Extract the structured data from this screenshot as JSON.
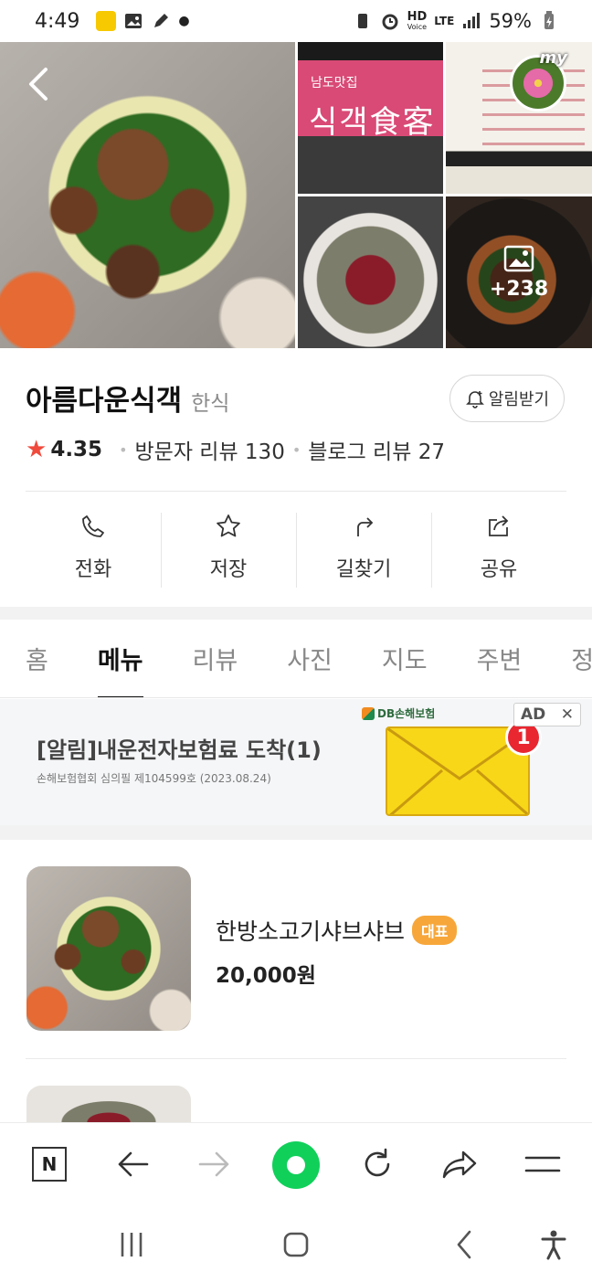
{
  "status_bar": {
    "time": "4:49",
    "hd_label": "HD",
    "voice_label": "Voice",
    "lte_label": "LTE",
    "battery": "59%"
  },
  "photos": {
    "sign_small": "남도맛집",
    "sign_big": "식객食客",
    "more_count": "+238"
  },
  "place": {
    "name": "아름다운식객",
    "category": "한식",
    "alarm_button": "알림받기",
    "rating": "4.35",
    "visitor_reviews": "방문자 리뷰 130",
    "blog_reviews": "블로그 리뷰 27"
  },
  "actions": [
    {
      "label": "전화",
      "icon": "phone-icon"
    },
    {
      "label": "저장",
      "icon": "star-icon"
    },
    {
      "label": "길찾기",
      "icon": "directions-icon"
    },
    {
      "label": "공유",
      "icon": "share-icon"
    }
  ],
  "tabs": [
    {
      "label": "홈"
    },
    {
      "label": "메뉴",
      "active": true
    },
    {
      "label": "리뷰"
    },
    {
      "label": "사진"
    },
    {
      "label": "지도"
    },
    {
      "label": "주변"
    },
    {
      "label": "정"
    }
  ],
  "ad": {
    "title": "[알림]내운전자보험료 도착(1)",
    "subtitle": "손해보험협회 심의필 제104599호 (2023.08.24)",
    "brand": "DB손해보험",
    "label": "AD",
    "close": "✕",
    "badge": "1"
  },
  "menu": [
    {
      "name": "한방소고기샤브샤브",
      "badge": "대표",
      "price": "20,000원"
    }
  ],
  "colors": {
    "rating_star": "#f04a3c",
    "badge": "#f7a73a",
    "accent_green": "#10d05a"
  }
}
